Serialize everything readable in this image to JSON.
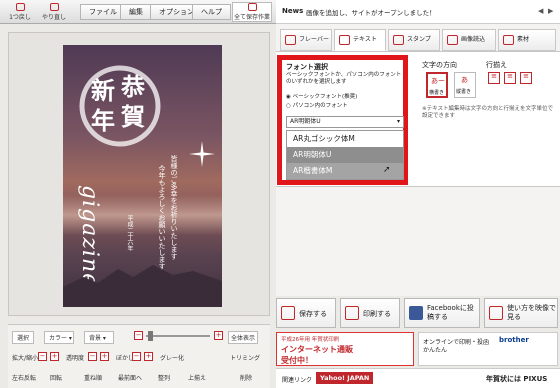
{
  "toolbar": {
    "undo_label": "1つ戻し",
    "redo_label": "やり直し",
    "menus": [
      "ファイル",
      "編集",
      "オプション",
      "ヘルプ"
    ],
    "save_label": "全て保存作業"
  },
  "news": {
    "label": "News",
    "text": "画像を追加し、サイトがオープンしました！"
  },
  "card": {
    "kanji": [
      "恭",
      "新",
      "賀",
      "年"
    ],
    "greeting_lines": [
      "皆様のご多幸をお祈りいたします",
      "今年もよろしくお願いいたします"
    ],
    "sig_lines": [
      "平成二十六年",
      "元旦"
    ],
    "handwritten": "gigazine"
  },
  "tabs": [
    "フレーバー",
    "テキスト",
    "スタンプ",
    "画像読込",
    "素材"
  ],
  "font_panel": {
    "heading": "フォント選択",
    "note": "ベーシックフォントか、パソコン内のフォントのいずれかを選択します",
    "options": [
      "ベーシックフォント(推奨)",
      "パソコン内のフォント"
    ],
    "selected_font": "AR明朝体U",
    "font_list": [
      "AR丸ゴシック体M",
      "AR明朝体U",
      "AR楷書体M"
    ]
  },
  "direction": {
    "heading": "文字の方向",
    "horizontal": "横書き",
    "vertical": "縦書き"
  },
  "align": {
    "heading": "行揃え"
  },
  "panel_note": "※テキスト編集時は文字の方向と行揃えを文字単位で設定できます",
  "actions": {
    "save": "保存する",
    "print": "印刷する",
    "facebook": "Facebookに投稿する",
    "howto": "使い方を映像で見る"
  },
  "banner": {
    "left_title": "インターネット通販",
    "left_sub": "受付中！",
    "left_tag": "平成26年用 年賀状印刷",
    "right_text": "オンラインで印刷・投函かんたん",
    "brand": "brother"
  },
  "footer": {
    "link": "関連リンク",
    "yahoo": "Yahoo! JAPAN",
    "pixus": "年賀状には PIXUS"
  },
  "bottom_tools": {
    "select": "選択",
    "color": "カラー",
    "bg": "背景",
    "zoom_label": "全体表示",
    "row1": [
      "拡大/縮小",
      "透明度",
      "ぼかし",
      "グレー化",
      "トリミング"
    ],
    "row2": [
      "左右反転",
      "回転",
      "重ね順",
      "最前面へ",
      "整列",
      "上揃え",
      "削除"
    ]
  },
  "colors": {
    "accent": "#c0272d",
    "highlight": "#e0161b"
  }
}
